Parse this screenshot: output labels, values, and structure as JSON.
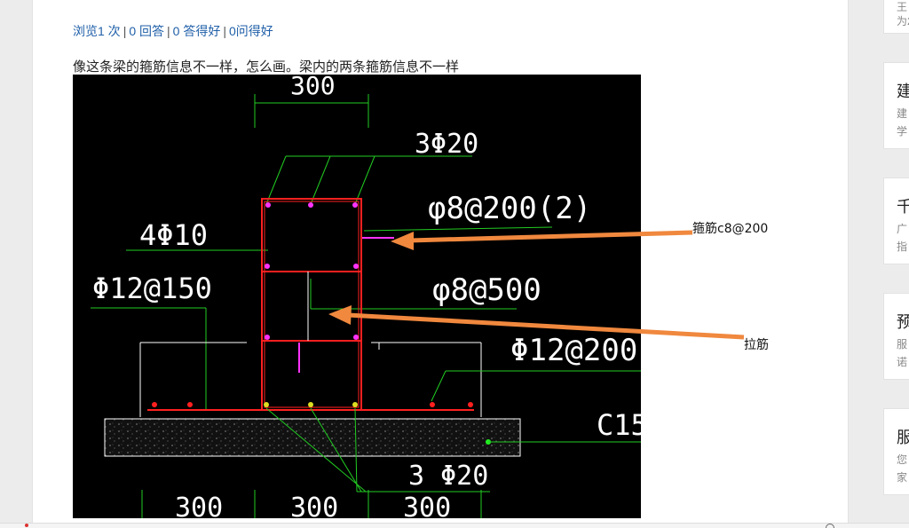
{
  "stats": {
    "views": "浏览1 次",
    "answers": "0 回答",
    "good_answers": "0 答得好",
    "good_questions": "0问得好",
    "separator": "|"
  },
  "question": {
    "text": "像这条梁的箍筋信息不一样，怎么画。梁内的两条箍筋信息不一样"
  },
  "drawing": {
    "dim_top": "300",
    "top_bars": "3Φ20",
    "stirrup_spec": "φ8@200(2)",
    "side_bars": "4Φ10",
    "tie_spec": "φ8@500",
    "flange_spec": "Φ12@150",
    "flange_bottom": "Φ12@200",
    "concrete": "C15",
    "bottom_bars": "3 Φ20",
    "dim_bottom_1": "300",
    "dim_bottom_2": "300",
    "dim_bottom_3": "300",
    "callout_stirrup": "箍筋c8@200",
    "callout_tie": "拉筋"
  },
  "sidebar": {
    "cards": [
      {
        "title": "",
        "line1": "王",
        "line2": "为2"
      },
      {
        "title": "建",
        "line1": "建",
        "line2": "学"
      },
      {
        "title": "千",
        "line1": "广",
        "line2": "指"
      },
      {
        "title": "预",
        "line1": "服",
        "line2": "诺"
      },
      {
        "title": "服",
        "line1": "您",
        "line2": "家"
      }
    ]
  },
  "colors": {
    "link": "#1f5fa8",
    "arrow": "#f0883e",
    "cad_green": "#22cc22",
    "cad_red": "#ff2020",
    "cad_magenta": "#ff33ff",
    "cad_white": "#ffffff"
  }
}
